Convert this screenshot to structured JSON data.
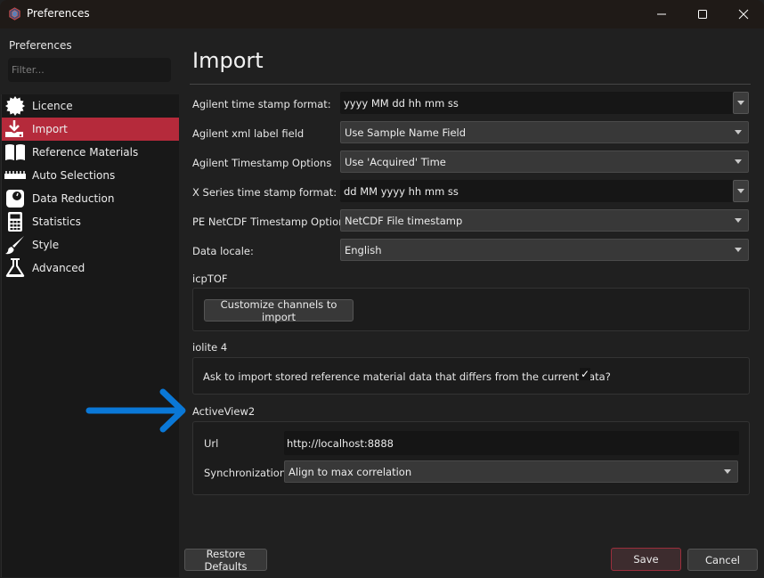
{
  "window": {
    "title": "Preferences",
    "controls": {
      "minimize": "minimize",
      "maximize": "maximize",
      "close": "close"
    }
  },
  "sidebar": {
    "title": "Preferences",
    "filter_placeholder": "Filter...",
    "filter_value": "",
    "items": [
      {
        "label": "Licence",
        "icon": "badge-icon",
        "active": false
      },
      {
        "label": "Import",
        "icon": "download-icon",
        "active": true
      },
      {
        "label": "Reference Materials",
        "icon": "book-icon",
        "active": false
      },
      {
        "label": "Auto Selections",
        "icon": "ruler-icon",
        "active": false
      },
      {
        "label": "Data Reduction",
        "icon": "scale-icon",
        "active": false
      },
      {
        "label": "Statistics",
        "icon": "calculator-icon",
        "active": false
      },
      {
        "label": "Style",
        "icon": "brush-icon",
        "active": false
      },
      {
        "label": "Advanced",
        "icon": "flask-icon",
        "active": false
      }
    ]
  },
  "main": {
    "title": "Import",
    "fields": [
      {
        "label": "Agilent time stamp format:",
        "value": "yyyy MM dd hh mm ss",
        "kind": "editable-combo"
      },
      {
        "label": "Agilent xml label field",
        "value": "Use Sample Name Field",
        "kind": "select"
      },
      {
        "label": "Agilent Timestamp Options",
        "value": "Use 'Acquired' Time",
        "kind": "select"
      },
      {
        "label": "X Series time stamp format:",
        "value": "dd MM yyyy hh mm ss",
        "kind": "editable-combo"
      },
      {
        "label": "PE NetCDF Timestamp Options",
        "value": "NetCDF File timestamp",
        "kind": "select"
      },
      {
        "label": "Data locale:",
        "value": "English",
        "kind": "select"
      }
    ],
    "icptof": {
      "title": "icpTOF",
      "button": "Customize channels to import"
    },
    "iolite": {
      "title": "iolite 4",
      "checkbox_label": "Ask to import stored reference material data that differs from the current data?",
      "checked": true,
      "check_glyph": "✓"
    },
    "activeview": {
      "title": "ActiveView2",
      "url_label": "Url",
      "url_value": "http://localhost:8888",
      "sync_label": "Synchronization",
      "sync_value": "Align to max correlation"
    }
  },
  "footer": {
    "restore": "Restore Defaults",
    "save": "Save",
    "cancel": "Cancel"
  },
  "annotation": {
    "arrow_color": "#0a78d7",
    "points_to": "ActiveView2"
  },
  "colors": {
    "accent": "#b52a3b",
    "background": "#202020",
    "sidebar": "#181818"
  }
}
